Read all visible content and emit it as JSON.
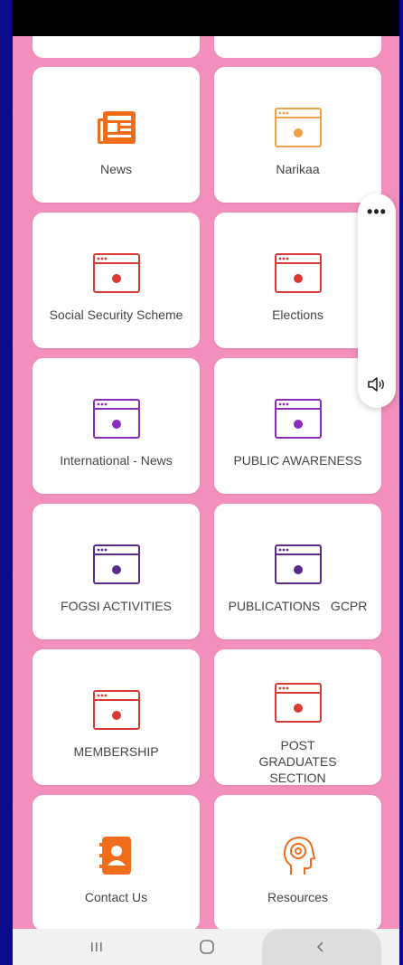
{
  "cards": [
    {
      "label": "News",
      "icon": "news-icon",
      "color": "#ef6c1a"
    },
    {
      "label": "Narikaa",
      "icon": "browser-window-icon",
      "color": "#f0a047"
    },
    {
      "label": "Social Security Scheme",
      "icon": "browser-window-icon",
      "color": "#d83a34"
    },
    {
      "label": "Elections",
      "icon": "browser-window-icon",
      "color": "#d83a34"
    },
    {
      "label": "International - News",
      "icon": "browser-window-icon",
      "color": "#8a2bbf"
    },
    {
      "label": "PUBLIC AWARENESS",
      "icon": "browser-window-icon",
      "color": "#8a2bbf"
    },
    {
      "label": "FOGSI ACTIVITIES",
      "icon": "browser-window-icon",
      "color": "#5a2a8a"
    },
    {
      "label": "PUBLICATIONS   GCPR",
      "icon": "browser-window-icon",
      "color": "#5a2a8a"
    },
    {
      "label": "MEMBERSHIP",
      "icon": "browser-window-icon",
      "color": "#d83a34"
    },
    {
      "label": "POST GRADUATES SECTION",
      "icon": "browser-window-icon",
      "color": "#d83a34"
    },
    {
      "label": "Contact Us",
      "icon": "contact-book-icon",
      "color": "#ef6c1a"
    },
    {
      "label": "Resources",
      "icon": "head-gear-icon",
      "color": "#ef6c1a"
    }
  ],
  "float_panel": {
    "menu_icon": "more-dots-icon",
    "sound_icon": "speaker-icon"
  },
  "navbar": {
    "recent": "recent-apps-icon",
    "home": "home-icon",
    "back": "back-icon"
  }
}
